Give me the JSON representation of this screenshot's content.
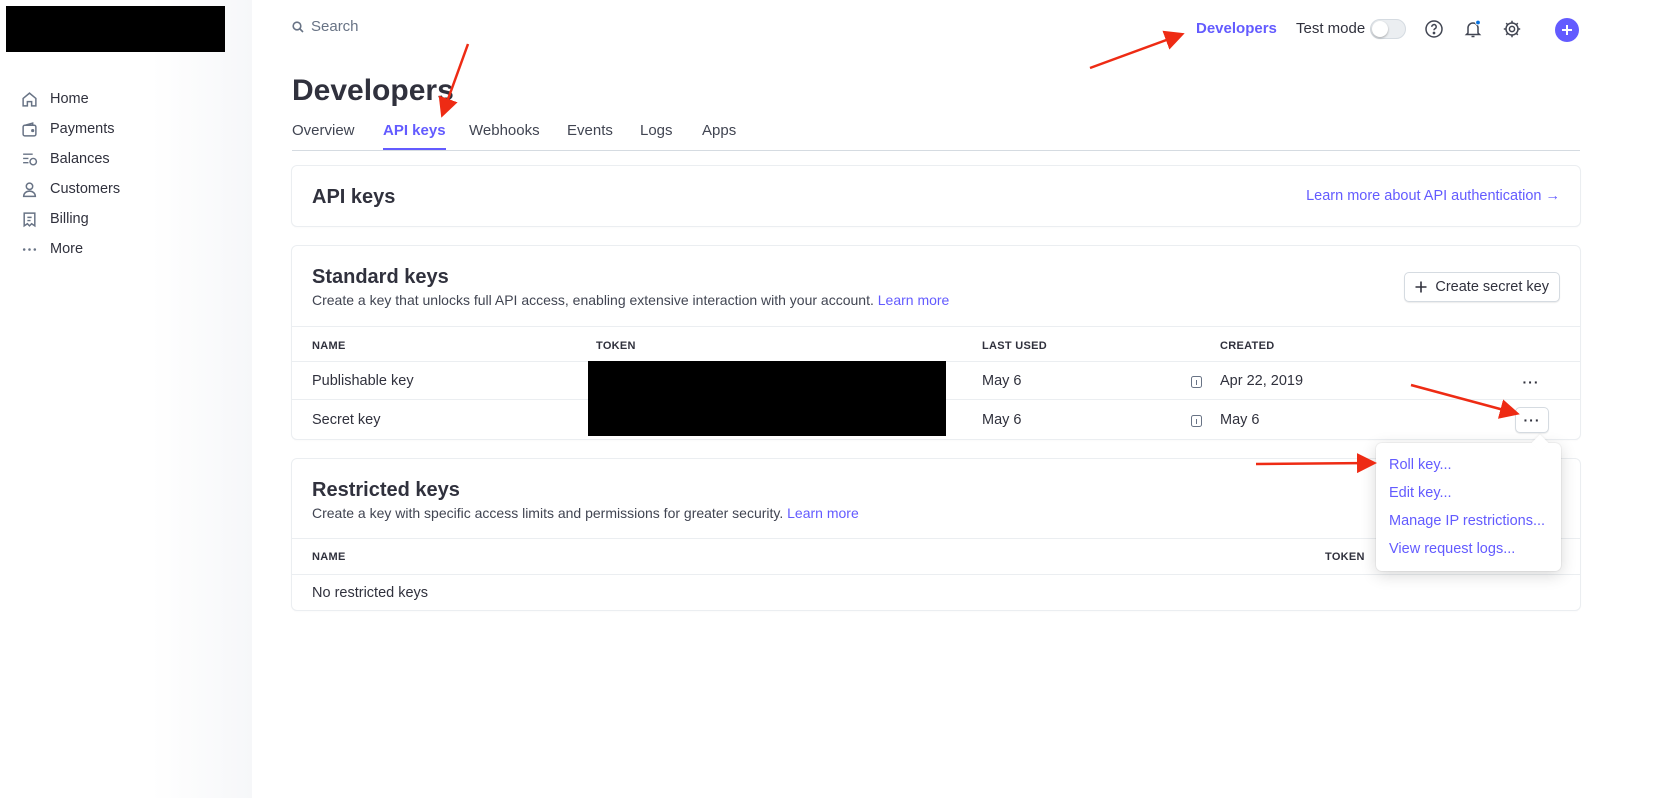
{
  "search": {
    "placeholder": "Search"
  },
  "header": {
    "developers_link": "Developers",
    "test_mode_label": "Test mode",
    "test_mode_on": false
  },
  "sidebar": {
    "items": [
      {
        "label": "Home",
        "icon": "home-icon"
      },
      {
        "label": "Payments",
        "icon": "wallet-icon"
      },
      {
        "label": "Balances",
        "icon": "balance-icon"
      },
      {
        "label": "Customers",
        "icon": "person-icon"
      },
      {
        "label": "Billing",
        "icon": "billing-icon"
      },
      {
        "label": "More",
        "icon": "more-icon"
      }
    ]
  },
  "page": {
    "title": "Developers",
    "tabs": [
      {
        "label": "Overview"
      },
      {
        "label": "API keys",
        "active": true
      },
      {
        "label": "Webhooks"
      },
      {
        "label": "Events"
      },
      {
        "label": "Logs"
      },
      {
        "label": "Apps"
      }
    ]
  },
  "api_keys_card": {
    "title": "API keys",
    "learn_more": "Learn more about API authentication →"
  },
  "standard_keys": {
    "title": "Standard keys",
    "description": "Create a key that unlocks full API access, enabling extensive interaction with your account.",
    "learn_more": "Learn more",
    "create_button": "Create secret key",
    "columns": [
      "NAME",
      "TOKEN",
      "LAST USED",
      "CREATED"
    ],
    "rows": [
      {
        "name": "Publishable key",
        "last_used": "May 6",
        "created": "Apr 22, 2019"
      },
      {
        "name": "Secret key",
        "last_used": "May 6",
        "created": "May 6"
      }
    ],
    "more_button": "···"
  },
  "restricted_keys": {
    "title": "Restricted keys",
    "description": "Create a key with specific access limits and permissions for greater security.",
    "learn_more": "Learn more",
    "columns": [
      "NAME",
      "TOKEN"
    ],
    "empty_text": "No restricted keys"
  },
  "menu": {
    "items": [
      "Roll key...",
      "Edit key...",
      "Manage IP restrictions...",
      "View request logs..."
    ]
  },
  "colors": {
    "accent": "#635bff",
    "annotation_arrow": "#ee2b14",
    "text": "#30313d"
  }
}
